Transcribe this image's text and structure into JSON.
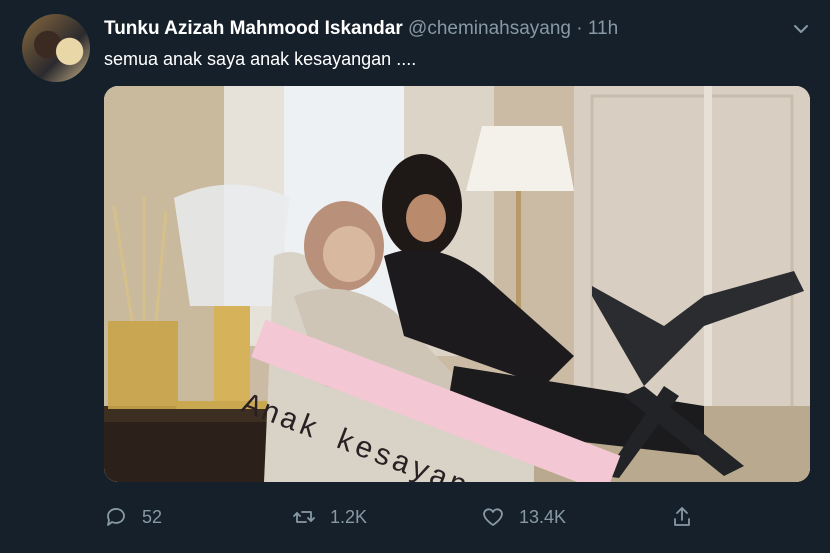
{
  "tweet": {
    "display_name": "Tunku Azizah Mahmood Iskandar",
    "handle": "@cheminahsayang",
    "separator": "·",
    "time": "11h",
    "text": "semua anak saya anak kesayangan ....",
    "image_sticker_text": "Anak kesayangan",
    "stats": {
      "replies": "52",
      "retweets": "1.2K",
      "likes": "13.4K"
    }
  },
  "icons": {
    "menu": "chevron-down-icon",
    "reply": "reply-icon",
    "retweet": "retweet-icon",
    "like": "heart-icon",
    "share": "share-icon"
  },
  "colors": {
    "background": "#15202b",
    "secondary_text": "#8899a6",
    "sticker_bg": "#f3c7d3"
  }
}
